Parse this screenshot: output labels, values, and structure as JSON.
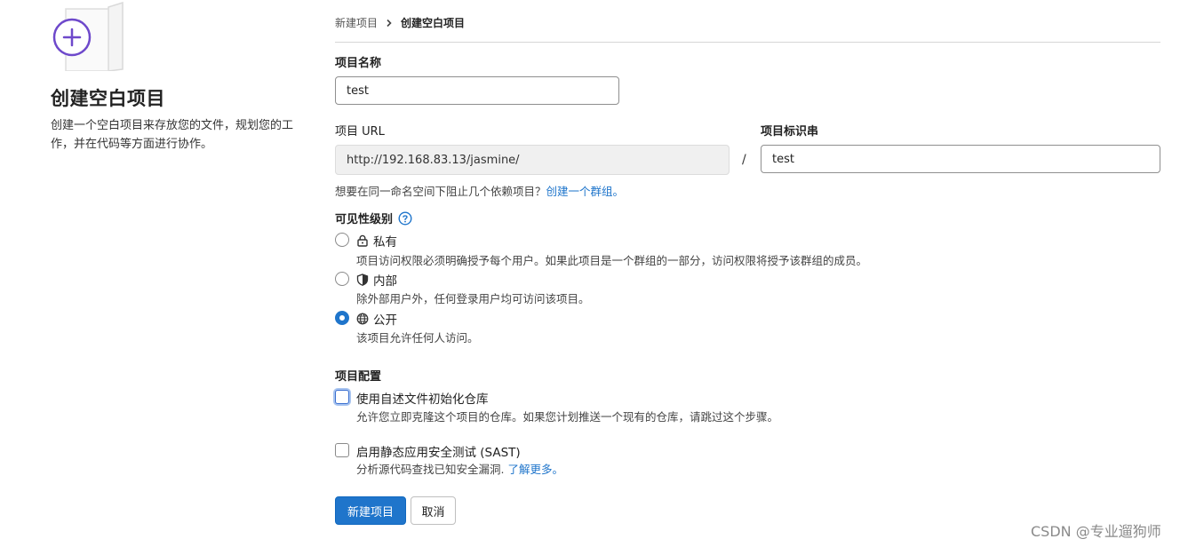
{
  "intro": {
    "title": "创建空白项目",
    "description": "创建一个空白项目来存放您的文件，规划您的工作，并在代码等方面进行协作。"
  },
  "breadcrumb": {
    "parent": "新建项目",
    "current": "创建空白项目"
  },
  "form": {
    "name_label": "项目名称",
    "name_value": "test",
    "url_label": "项目 URL",
    "url_value": "http://192.168.83.13/jasmine/",
    "separator": "/",
    "slug_label": "项目标识串",
    "slug_value": "test",
    "group_hint": "想要在同一命名空间下阻止几个依赖项目？",
    "group_link": "创建一个群组。"
  },
  "visibility": {
    "label": "可见性级别",
    "options": [
      {
        "title": "私有",
        "desc": "项目访问权限必须明确授予每个用户。如果此项目是一个群组的一部分，访问权限将授予该群组的成员。",
        "icon": "lock-icon",
        "checked": false
      },
      {
        "title": "内部",
        "desc": "除外部用户外，任何登录用户均可访问该项目。",
        "icon": "shield-icon",
        "checked": false
      },
      {
        "title": "公开",
        "desc": "该项目允许任何人访问。",
        "icon": "globe-icon",
        "checked": true
      }
    ]
  },
  "config": {
    "label": "项目配置",
    "readme_title": "使用自述文件初始化仓库",
    "readme_desc": "允许您立即克隆这个项目的仓库。如果您计划推送一个现有的仓库，请跳过这个步骤。",
    "sast_title": "启用静态应用安全测试 (SAST)",
    "sast_desc": "分析源代码查找已知安全漏洞.",
    "sast_link": "了解更多。"
  },
  "actions": {
    "create": "新建项目",
    "cancel": "取消"
  },
  "watermark": "CSDN @专业遛狗师",
  "colors": {
    "accent": "#1f75cb",
    "illustration_purple": "#6e49cb"
  }
}
